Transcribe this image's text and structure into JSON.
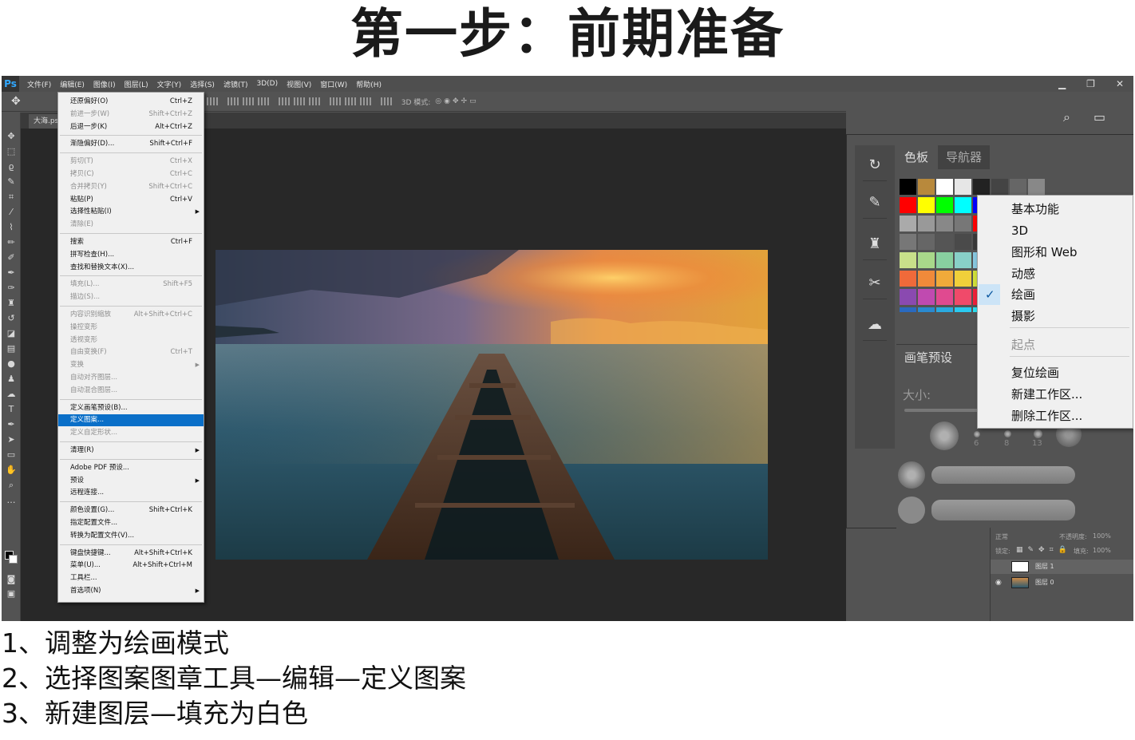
{
  "heading": "第一步：前期准备",
  "app": {
    "logo": "Ps",
    "menubar": [
      "文件(F)",
      "编辑(E)",
      "图像(I)",
      "图层(L)",
      "文字(Y)",
      "选择(S)",
      "滤镜(T)",
      "3D(D)",
      "视图(V)",
      "窗口(W)",
      "帮助(H)"
    ],
    "window_controls": {
      "minimize": "▁",
      "restore": "❐",
      "close": "✕"
    },
    "options_label": "3D 模式:",
    "doc_tab": "大海.psd"
  },
  "edit_menu": {
    "items": [
      {
        "label": "还原偏好(O)",
        "shortcut": "Ctrl+Z",
        "disabled": false
      },
      {
        "label": "前进一步(W)",
        "shortcut": "Shift+Ctrl+Z",
        "disabled": true
      },
      {
        "label": "后退一步(K)",
        "shortcut": "Alt+Ctrl+Z",
        "disabled": false
      },
      {
        "label": "渐隐偏好(D)...",
        "shortcut": "Shift+Ctrl+F",
        "disabled": false
      },
      {
        "label": "剪切(T)",
        "shortcut": "Ctrl+X",
        "disabled": true
      },
      {
        "label": "拷贝(C)",
        "shortcut": "Ctrl+C",
        "disabled": true
      },
      {
        "label": "合并拷贝(Y)",
        "shortcut": "Shift+Ctrl+C",
        "disabled": true
      },
      {
        "label": "粘贴(P)",
        "shortcut": "Ctrl+V",
        "disabled": false
      },
      {
        "label": "选择性粘贴(I)",
        "shortcut": "",
        "disabled": false,
        "submenu": true
      },
      {
        "label": "清除(E)",
        "shortcut": "",
        "disabled": true
      },
      {
        "label": "搜索",
        "shortcut": "Ctrl+F",
        "disabled": false
      },
      {
        "label": "拼写检查(H)...",
        "shortcut": "",
        "disabled": false
      },
      {
        "label": "查找和替换文本(X)...",
        "shortcut": "",
        "disabled": false
      },
      {
        "label": "填充(L)...",
        "shortcut": "Shift+F5",
        "disabled": true
      },
      {
        "label": "描边(S)...",
        "shortcut": "",
        "disabled": true
      },
      {
        "label": "内容识别缩放",
        "shortcut": "Alt+Shift+Ctrl+C",
        "disabled": true
      },
      {
        "label": "操控变形",
        "shortcut": "",
        "disabled": true
      },
      {
        "label": "透视变形",
        "shortcut": "",
        "disabled": true
      },
      {
        "label": "自由变换(F)",
        "shortcut": "Ctrl+T",
        "disabled": true
      },
      {
        "label": "变换",
        "shortcut": "",
        "disabled": true,
        "submenu": true
      },
      {
        "label": "自动对齐图层...",
        "shortcut": "",
        "disabled": true
      },
      {
        "label": "自动混合图层...",
        "shortcut": "",
        "disabled": true
      },
      {
        "label": "定义画笔预设(B)...",
        "shortcut": "",
        "disabled": false
      },
      {
        "label": "定义图案...",
        "shortcut": "",
        "disabled": false,
        "selected": true
      },
      {
        "label": "定义自定形状...",
        "shortcut": "",
        "disabled": true
      },
      {
        "label": "清理(R)",
        "shortcut": "",
        "disabled": false,
        "submenu": true
      },
      {
        "label": "Adobe PDF 预设...",
        "shortcut": "",
        "disabled": false
      },
      {
        "label": "预设",
        "shortcut": "",
        "disabled": false,
        "submenu": true
      },
      {
        "label": "远程连接...",
        "shortcut": "",
        "disabled": false
      },
      {
        "label": "颜色设置(G)...",
        "shortcut": "Shift+Ctrl+K",
        "disabled": false
      },
      {
        "label": "指定配置文件...",
        "shortcut": "",
        "disabled": false
      },
      {
        "label": "转换为配置文件(V)...",
        "shortcut": "",
        "disabled": false
      },
      {
        "label": "键盘快捷键...",
        "shortcut": "Alt+Shift+Ctrl+K",
        "disabled": false
      },
      {
        "label": "菜单(U)...",
        "shortcut": "Alt+Shift+Ctrl+M",
        "disabled": false
      },
      {
        "label": "工具栏...",
        "shortcut": "",
        "disabled": false
      },
      {
        "label": "首选项(N)",
        "shortcut": "",
        "disabled": false,
        "submenu": true
      }
    ]
  },
  "panels": {
    "swatches_tab": "色板",
    "navigator_tab": "导航器",
    "brush_presets_tab": "画笔预设",
    "brush_size_label": "大小:",
    "brush_numbers": [
      "6",
      "8",
      "13"
    ]
  },
  "workspace_menu": {
    "items": [
      {
        "label": "基本功能",
        "disabled": false
      },
      {
        "label": "3D",
        "disabled": false
      },
      {
        "label": "图形和 Web",
        "disabled": false
      },
      {
        "label": "动感",
        "disabled": false
      },
      {
        "label": "绘画",
        "disabled": false,
        "checked": true
      },
      {
        "label": "摄影",
        "disabled": false
      },
      {
        "label": "起点",
        "disabled": true
      },
      {
        "label": "复位绘画",
        "disabled": false
      },
      {
        "label": "新建工作区...",
        "disabled": false
      },
      {
        "label": "删除工作区...",
        "disabled": false
      }
    ]
  },
  "layers": {
    "blend_mode": "正常",
    "opacity_label": "不透明度:",
    "opacity": "100%",
    "lock_label": "锁定:",
    "fill_label": "填充:",
    "fill": "100%",
    "rows": [
      {
        "name": "图层 1",
        "thumb": "white"
      },
      {
        "name": "图层 0",
        "thumb": "photo"
      }
    ]
  },
  "steps": [
    "1、调整为绘画模式",
    "2、选择图案图章工具—编辑—定义图案",
    "3、新建图层—填充为白色"
  ],
  "colors": {
    "ps_bg": "#535353",
    "canvas_bg": "#282828",
    "menu_highlight": "#0a6fc8",
    "ps_logo": "#31a8ff"
  }
}
